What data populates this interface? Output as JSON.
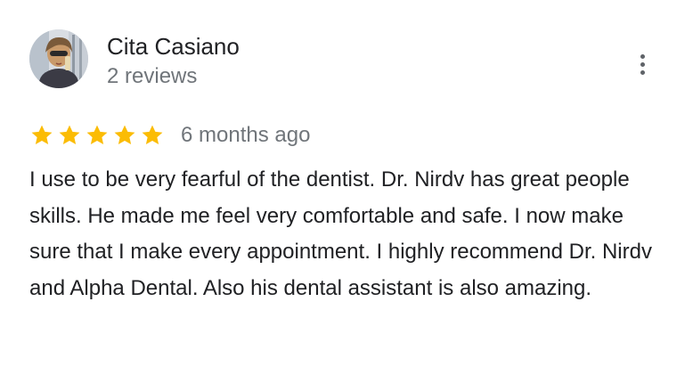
{
  "review": {
    "author_name": "Cita Casiano",
    "review_count": "2 reviews",
    "rating": 5,
    "max_rating": 5,
    "date": "6 months ago",
    "text": "I use to be very fearful of the dentist. Dr. Nirdv has great people skills. He made me feel very comfortable and safe. I now make sure that I make every appointment. I highly recommend Dr. Nirdv and Alpha Dental. Also his dental assistant is also amazing."
  },
  "icons": {
    "star": "star-icon",
    "more": "more-vert-icon",
    "avatar": "profile-photo"
  },
  "colors": {
    "star": "#fbbc04",
    "secondary_text": "#70757a",
    "primary_text": "#202124"
  }
}
